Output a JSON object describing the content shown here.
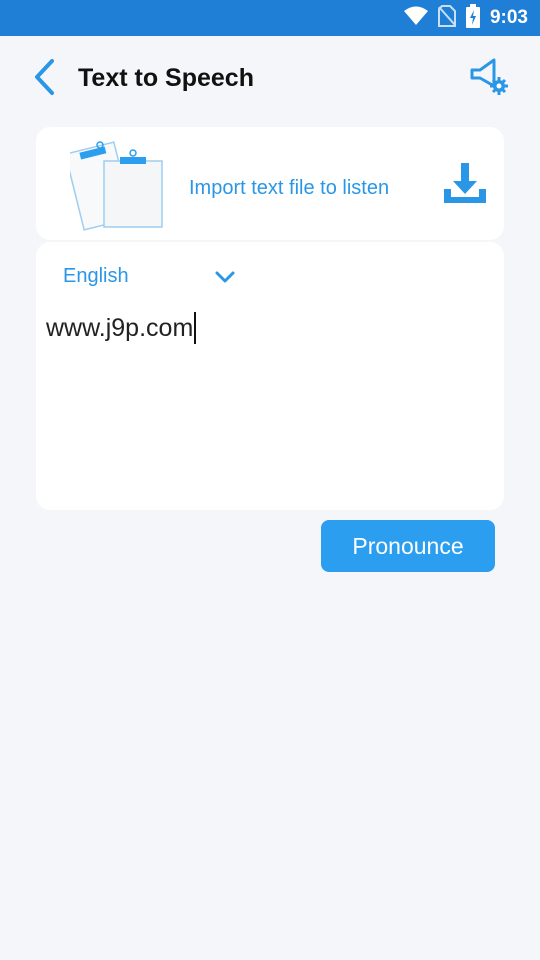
{
  "status_bar": {
    "time": "9:03",
    "icons": [
      "wifi-icon",
      "no-sim-icon",
      "battery-charging-icon"
    ]
  },
  "header": {
    "title": "Text to Speech",
    "back_icon": "chevron-left-icon",
    "settings_icon": "speaker-settings-icon"
  },
  "import_card": {
    "label": "Import text file to listen",
    "illustration_icon": "clipboard-icon",
    "action_icon": "download-icon"
  },
  "editor": {
    "language": "English",
    "dropdown_icon": "chevron-down-icon",
    "text_value": "www.j9p.com"
  },
  "actions": {
    "pronounce_label": "Pronounce"
  },
  "colors": {
    "status_bar": "#1f7fd6",
    "accent": "#2a97e6",
    "button": "#2b9ef0",
    "background": "#f5f6fa"
  }
}
